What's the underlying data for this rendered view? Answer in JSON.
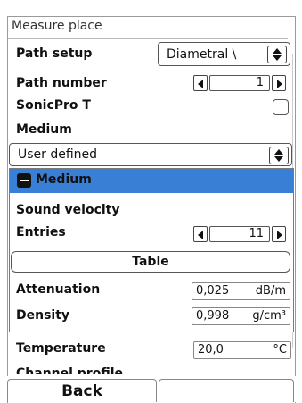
{
  "window": {
    "title": "Measure place"
  },
  "path_setup": {
    "label": "Path setup",
    "value": "Diametral \\"
  },
  "path_number": {
    "label": "Path number",
    "value": "1"
  },
  "sonicpro": {
    "label": "SonicPro T"
  },
  "medium": {
    "label": "Medium",
    "value": "User defined"
  },
  "popup": {
    "title": "Medium",
    "sound_velocity_label": "Sound velocity",
    "entries_label": "Entries",
    "entries_value": "11",
    "table_button": "Table",
    "attenuation_label": "Attenuation",
    "attenuation_value": "0,025",
    "attenuation_unit": "dB/m",
    "density_label": "Density",
    "density_value": "0,998",
    "density_unit": "g/cm³"
  },
  "temperature": {
    "label": "Temperature",
    "value": "20,0",
    "unit": "°C"
  },
  "channel_profile": {
    "label": "Channel profile"
  },
  "footer": {
    "back_label": "Back"
  },
  "colors": {
    "header_blue": "#3a7fd6"
  }
}
